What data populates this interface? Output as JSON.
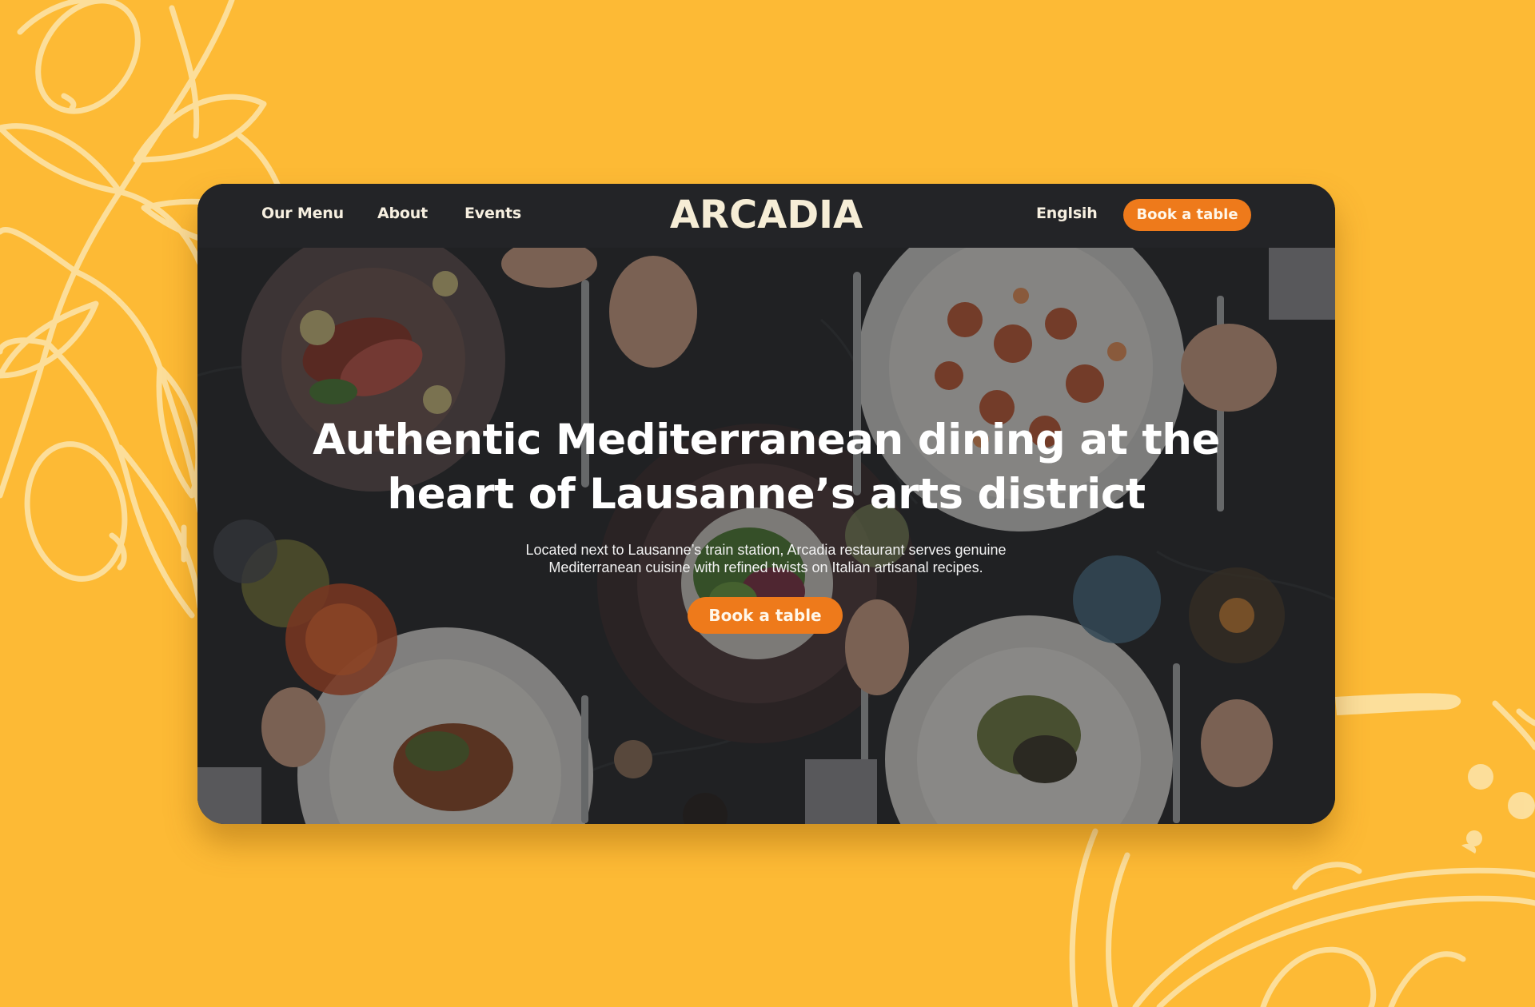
{
  "nav": {
    "links": [
      "Our Menu",
      "About",
      "Events"
    ],
    "language": "Englsih",
    "cta_label": "Book a table"
  },
  "brand": {
    "logo_text": "ARCADIA"
  },
  "hero": {
    "title": "Authentic Mediterranean dining at the heart of Lausanne’s arts district",
    "subtitle": "Located next to Lausanne’s train station, Arcadia restaurant serves genuine Mediterranean cuisine with refined twists on Italian artisanal recipes.",
    "cta_label": "Book a table",
    "background_image": "overhead-view-of-restaurant-table-with-plates-and-cocktails"
  },
  "colors": {
    "page_background": "#FDBA35",
    "navbar_background": "#232427",
    "accent": "#EE7A1B",
    "logo": "#F6EDD6",
    "decoration": "#FCE3A6"
  },
  "icons": [
    "olive-branch-decoration",
    "dish-sketch-decoration"
  ]
}
